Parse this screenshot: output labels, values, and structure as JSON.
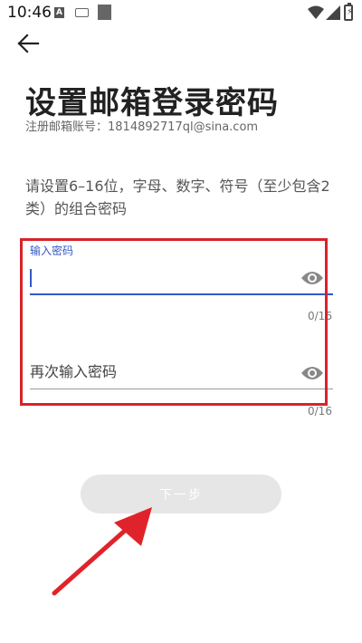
{
  "status_bar": {
    "time": "10:46",
    "icons": [
      "a-icon",
      "keyboard-icon",
      "square-icon",
      "wifi-icon",
      "signal-icon",
      "battery-icon"
    ]
  },
  "header": {
    "back_icon": "arrow-left-icon"
  },
  "title": "设置邮箱登录密码",
  "email": {
    "label": "注册邮箱账号：",
    "value": "1814892717ql@sina.com"
  },
  "hint": "请设置6–16位，字母、数字、符号（至少包含2类）的组合密码",
  "password_field": {
    "label": "输入密码",
    "value": "",
    "counter": "0/16",
    "icon": "eye-icon"
  },
  "confirm_field": {
    "placeholder": "再次输入密码",
    "value": "",
    "counter": "0/16",
    "icon": "eye-icon"
  },
  "next_button": {
    "label": "下一步"
  },
  "colors": {
    "accent": "#3558c8",
    "annotation": "#d8232a",
    "button_disabled": "#e6e6e6"
  }
}
